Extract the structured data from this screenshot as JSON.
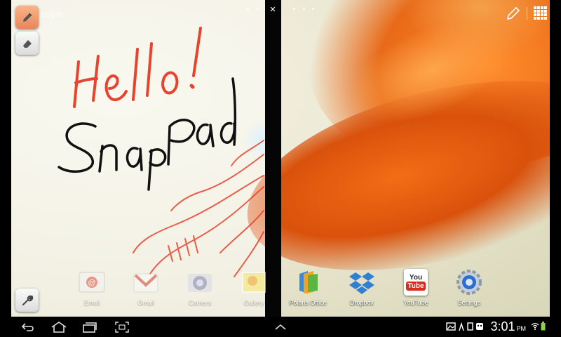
{
  "left_pane": {
    "ghost_search_text": "oogle",
    "tools": {
      "pen_icon": "pen-icon",
      "eraser_icon": "eraser-icon",
      "settings_icon": "wrench-icon"
    },
    "close_icon": "×",
    "handwriting": {
      "line1": "Hello!",
      "line2": "SnapPad",
      "line1_color": "#e8432e",
      "line2_color": "#111111"
    }
  },
  "right_pane": {
    "top_icons": [
      "pencil-icon",
      "apps-grid-icon"
    ]
  },
  "dock": {
    "apps": [
      {
        "label": "Email",
        "icon": "email-icon"
      },
      {
        "label": "Gmail",
        "icon": "gmail-icon"
      },
      {
        "label": "Camera",
        "icon": "camera-icon"
      },
      {
        "label": "Gallery",
        "icon": "gallery-icon"
      },
      {
        "label": "Polaris Office",
        "icon": "polaris-office-icon"
      },
      {
        "label": "Dropbox",
        "icon": "dropbox-icon"
      },
      {
        "label": "YouTube",
        "icon": "youtube-icon"
      },
      {
        "label": "Settings",
        "icon": "settings-gear-icon"
      }
    ],
    "youtube_logo_text": {
      "top": "You",
      "bottom": "Tube"
    }
  },
  "navbar": {
    "buttons": [
      "back-icon",
      "home-icon",
      "recent-apps-icon",
      "screenshot-icon",
      "chevron-up-icon"
    ],
    "status_icons": [
      "gallery-notify-icon",
      "usb-icon",
      "sd-icon",
      "bbm-icon",
      "wifi-icon",
      "battery-icon"
    ],
    "time": "3:01",
    "ampm": "PM"
  },
  "colors": {
    "accent_pen": "#e9865a",
    "ink_red": "#e8432e",
    "ink_black": "#111111",
    "orange_petal": "#e5601a"
  }
}
